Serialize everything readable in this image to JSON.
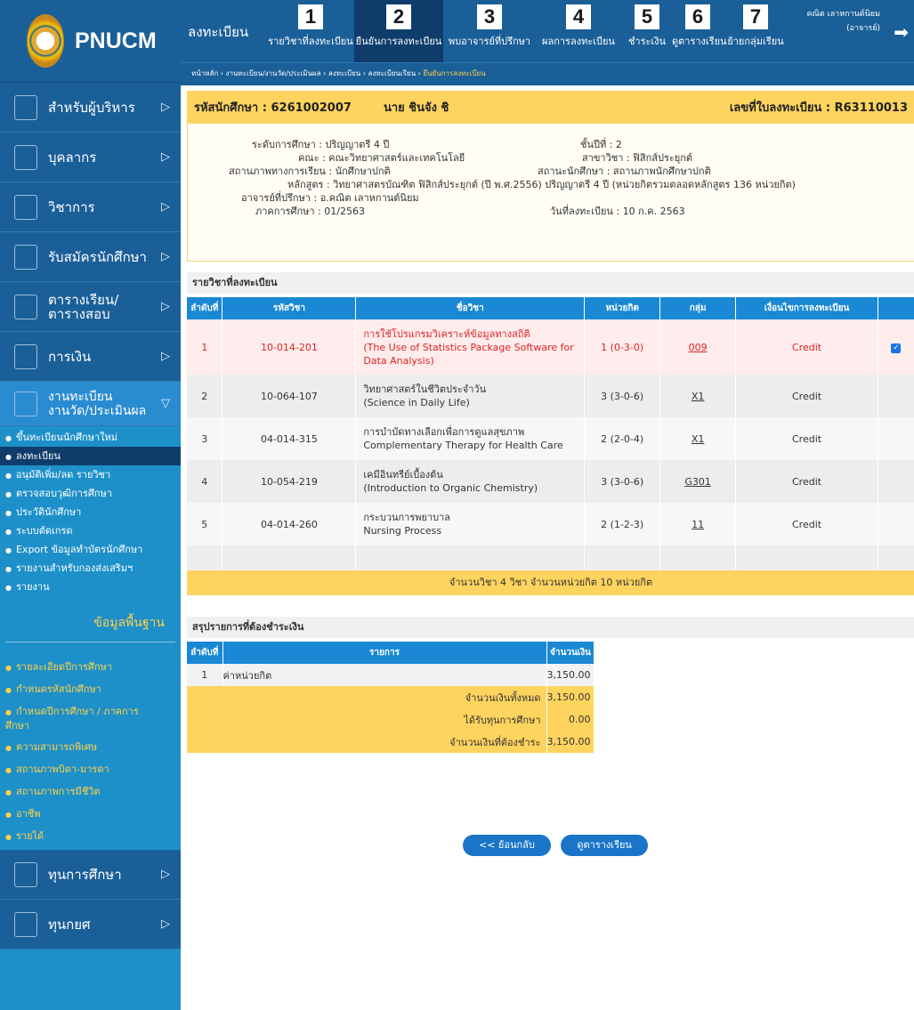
{
  "logo": {
    "name": "PNUCM"
  },
  "sidebar": {
    "menus": [
      {
        "label": "สำหรับผู้บริหาร"
      },
      {
        "label": "บุคลากร"
      },
      {
        "label": "วิชาการ"
      },
      {
        "label": "รับสมัครนักศึกษา"
      },
      {
        "label": "ตารางเรียน/ ตารางสอบ"
      },
      {
        "label": "การเงิน"
      }
    ],
    "open": {
      "line1": "งานทะเบียน",
      "line2": "งานวัด/ประเมินผล"
    },
    "items": [
      "ขึ้นทะเบียนนักศึกษาใหม่",
      "ลงทะเบียน",
      "อนุมัติเพิ่ม/ลด รายวิชา",
      "ตรวจสอบวุฒิการศึกษา",
      "ประวัตินักศึกษา",
      "ระบบตัดเกรด",
      "Export ข้อมูลทำบัตรนักศึกษา",
      "รายงานสำหรับกองส่งเสริมฯ",
      "รายงาน"
    ],
    "basic_title": "ข้อมูลพื้นฐาน",
    "basic_items": [
      "รายละเอียดปีการศึกษา",
      "กำหนดรหัสนักศึกษา",
      "กำหนดปีการศึกษา / ภาคการศึกษา",
      "ความสามารถพิเศษ",
      "สถานภาพบิดา-มารดา",
      "สถานภาพการมีชีวิต",
      "อาชีพ",
      "รายได้"
    ],
    "bottom": [
      {
        "label": "ทุนการศึกษา"
      },
      {
        "label": "ทุนกยศ"
      }
    ]
  },
  "topbar": {
    "title": "ลงทะเบียน",
    "steps": [
      {
        "num": "1",
        "label": "รายวิชาที่ลงทะเบียน"
      },
      {
        "num": "2",
        "label": "ยืนยันการลงทะเบียน"
      },
      {
        "num": "3",
        "label": "พบอาจารย์ที่ปรึกษา"
      },
      {
        "num": "4",
        "label": "ผลการลงทะเบียน"
      },
      {
        "num": "5",
        "label": "ชำระเงิน"
      },
      {
        "num": "6",
        "label": "ดูตารางเรียน"
      },
      {
        "num": "7",
        "label": "ย้ายกลุ่มเรียน"
      }
    ],
    "user": "คณิต เลาหกานต์นิยม",
    "role": "(อาจารย์)"
  },
  "breadcrumb": {
    "path": "หน้าหลัก › งานทะเบียน/งานวัด/ประเมินผล › ลงทะเบียน › ลงทะเบียนเรียน › ",
    "current": "ยืนยันการลงทะเบียน"
  },
  "student": {
    "id_label": "รหัสนักศึกษา : 6261002007",
    "name": "นาย ชินจัง ชิ",
    "reg_label": "เลขที่ใบลงทะเบียน : R63110013"
  },
  "info": {
    "level": "ระดับการศึกษา : ปริญญาตรี 4 ปี",
    "faculty": "คณะ : คณะวิทยาศาสตร์และเทคโนโลยี",
    "status": "สถานภาพทางการเรียน : นักศึกษาปกติ",
    "program": "หลักสูตร : วิทยาศาสตรบัณฑิต ฟิสิกส์ประยุกต์ (ปี พ.ศ.2556) ปริญญาตรี 4 ปี (หน่วยกิตรวมตลอดหลักสูตร 136 หน่วยกิต)",
    "advisor": "อาจารย์ที่ปรึกษา : อ.คณิต เลาหกานต์นิยม",
    "semester": "ภาคการศึกษา : 01/2563",
    "year": "ชั้นปีที่ : 2",
    "major": "สาขาวิชา : ฟิสิกส์ประยุกต์",
    "stu_status": "สถานะนักศึกษา : สถานภาพนักศึกษาปกติ",
    "reg_date": "วันที่ลงทะเบียน : 10 ก.ค. 2563"
  },
  "courses": {
    "section": "รายวิชาที่ลงทะเบียน",
    "headers": [
      "ลำดับที่",
      "รหัสวิชา",
      "ชื่อวิชา",
      "หน่วยกิต",
      "กลุ่ม",
      "เงื่อนไขการลงทะเบียน"
    ],
    "rows": [
      {
        "no": "1",
        "code": "10-014-201",
        "name_th": "การใช้โปรแกรมวิเคราะห์ข้อมูลทางสถิติ",
        "name_en1": "(The Use of Statistics Package Software for",
        "name_en2": "Data Analysis)",
        "credit": "1 (0-3-0)",
        "group": "009",
        "cond": "Credit"
      },
      {
        "no": "2",
        "code": "10-064-107",
        "name_th": "วิทยาศาสตร์ในชีวิตประจำวัน",
        "name_en1": "(Science in Daily Life)",
        "credit": "3 (3-0-6)",
        "group": "X1",
        "cond": "Credit"
      },
      {
        "no": "3",
        "code": "04-014-315",
        "name_th": "การบำบัดทางเลือกเพื่อการดูแลสุขภาพ",
        "name_en1": "Complementary Therapy for Health Care",
        "credit": "2 (2-0-4)",
        "group": "X1",
        "cond": "Credit"
      },
      {
        "no": "4",
        "code": "10-054-219",
        "name_th": "เคมีอินทรีย์เบื้องต้น",
        "name_en1": "(Introduction to Organic Chemistry)",
        "credit": "3 (3-0-6)",
        "group": "G301",
        "cond": "Credit"
      },
      {
        "no": "5",
        "code": "04-014-260",
        "name_th": "กระบวนการพยาบาล",
        "name_en1": "Nursing Process",
        "credit": "2 (1-2-3)",
        "group": "11",
        "cond": "Credit"
      }
    ],
    "summary": "จำนวนวิชา 4 วิชา จำนวนหน่วยกิต 10 หน่วยกิต"
  },
  "payment": {
    "section": "สรุปรายการที่ต้องชำระเงิน",
    "headers": [
      "ลำดับที่",
      "รายการ",
      "จำนวนเงิน"
    ],
    "row": {
      "no": "1",
      "item": "ค่าหน่วยกิต",
      "amount": "3,150.00"
    },
    "totals": [
      {
        "label": "จำนวนเงินทั้งหมด",
        "value": "3,150.00"
      },
      {
        "label": "ได้รับทุนการศึกษา",
        "value": "0.00"
      },
      {
        "label": "จำนวนเงินที่ต้องชำระ",
        "value": "3,150.00"
      }
    ]
  },
  "buttons": {
    "back": "<< ย้อนกลับ",
    "schedule": "ดูตารางเรียน"
  }
}
